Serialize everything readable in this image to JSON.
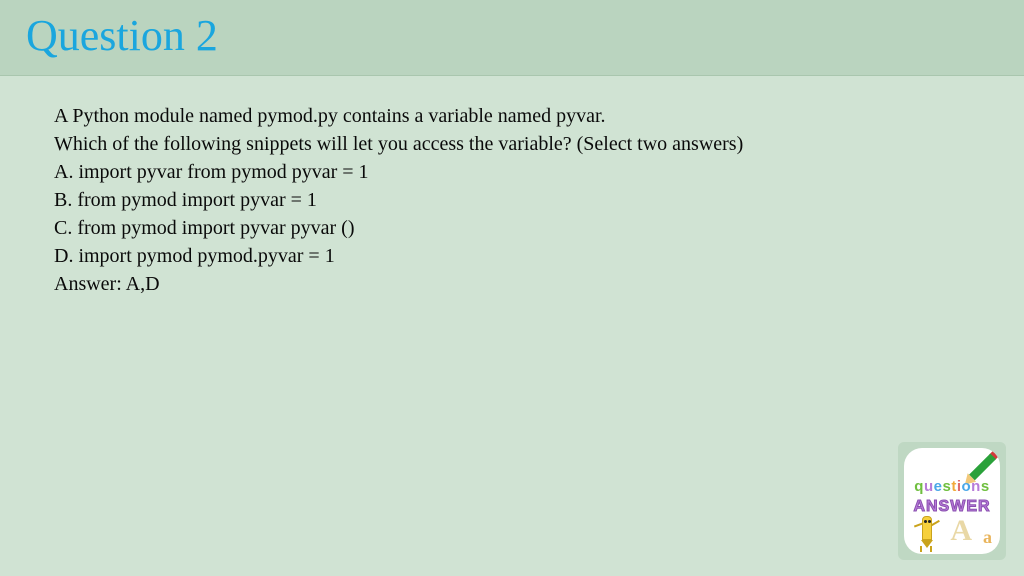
{
  "title": "Question 2",
  "question": {
    "prompt_line1": "A Python module named pymod.py contains a variable named pyvar.",
    "prompt_line2": "Which of the following snippets will let you access the variable? (Select two answers)",
    "options": {
      "A": "A. import pyvar from pymod pyvar = 1",
      "B": "B. from pymod import pyvar = 1",
      "C": "C. from pymod import pyvar pyvar ()",
      "D": "D. import pymod pymod.pyvar = 1"
    },
    "answer_line": "Answer: A,D"
  },
  "badge": {
    "word_questions": "questions",
    "word_answer": "ANSWER"
  }
}
